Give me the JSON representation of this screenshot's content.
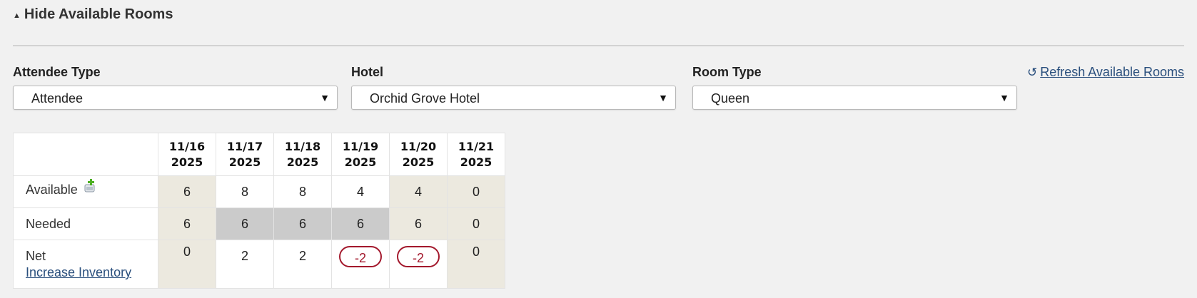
{
  "section": {
    "toggle_label": "Hide Available Rooms"
  },
  "filters": {
    "attendee_type": {
      "label": "Attendee Type",
      "value": "Attendee"
    },
    "hotel": {
      "label": "Hotel",
      "value": "Orchid Grove Hotel"
    },
    "room_type": {
      "label": "Room Type",
      "value": "Queen"
    }
  },
  "refresh": {
    "label": "Refresh Available Rooms",
    "icon": "refresh-icon"
  },
  "grid": {
    "columns": [
      {
        "date": "11/16",
        "year": "2025"
      },
      {
        "date": "11/17",
        "year": "2025"
      },
      {
        "date": "11/18",
        "year": "2025"
      },
      {
        "date": "11/19",
        "year": "2025"
      },
      {
        "date": "11/20",
        "year": "2025"
      },
      {
        "date": "11/21",
        "year": "2025"
      }
    ],
    "rows": {
      "available": {
        "label": "Available",
        "values": [
          "6",
          "8",
          "8",
          "4",
          "4",
          "0"
        ]
      },
      "needed": {
        "label": "Needed",
        "values": [
          "6",
          "6",
          "6",
          "6",
          "6",
          "0"
        ]
      },
      "net": {
        "label": "Net",
        "link": "Increase Inventory",
        "values": [
          "0",
          "2",
          "2",
          "-2",
          "-2",
          "0"
        ]
      }
    }
  },
  "colors": {
    "link": "#2a4f7d",
    "negative": "#a3182c",
    "beige_cell": "#ece9df",
    "gray_cell": "#cbcbcb",
    "add_icon_green": "#4caf22"
  }
}
